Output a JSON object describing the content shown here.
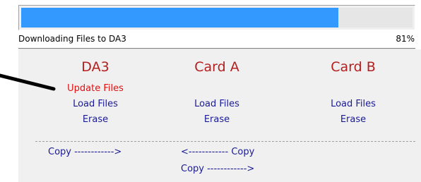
{
  "progress": {
    "fraction": 0.81,
    "status_text": "Downloading Files to DA3",
    "percent_text": "81%"
  },
  "columns": [
    {
      "title": "DA3",
      "actions": [
        {
          "label": "Update Files",
          "active": true
        },
        {
          "label": "Load Files",
          "active": false
        },
        {
          "label": "Erase",
          "active": false
        }
      ]
    },
    {
      "title": "Card A",
      "actions": [
        {
          "label": "Load Files",
          "active": false
        },
        {
          "label": "Erase",
          "active": false
        }
      ]
    },
    {
      "title": "Card B",
      "actions": [
        {
          "label": "Load Files",
          "active": false
        },
        {
          "label": "Erase",
          "active": false
        }
      ]
    }
  ],
  "copy_links": [
    {
      "label": "Copy ------------>"
    },
    {
      "label": "<------------ Copy"
    },
    {
      "label": "Copy ------------>"
    }
  ],
  "colors": {
    "progress_fill": "#3399ff",
    "title": "#b41e1e",
    "link": "#1a1a96",
    "link_active": "#e01010"
  }
}
